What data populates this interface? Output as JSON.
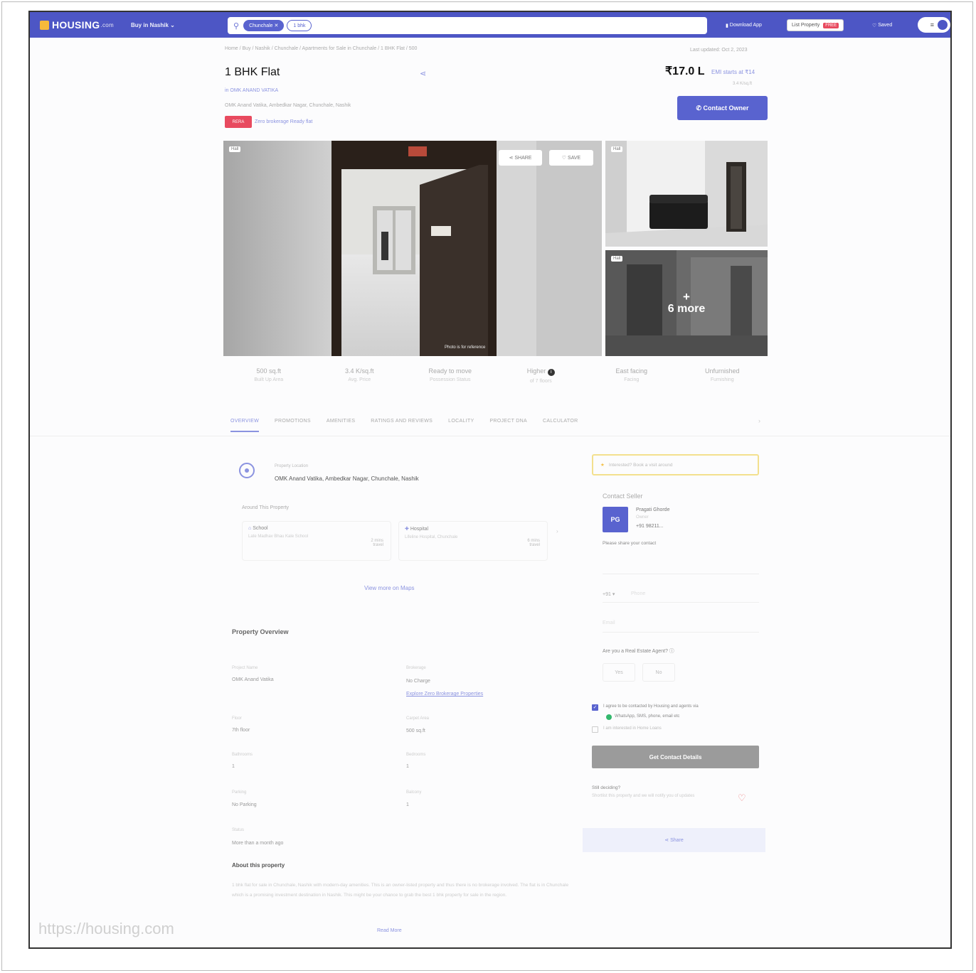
{
  "navbar": {
    "logo": "HOUSING",
    "logo_suffix": ".com",
    "city": "Buy in Nashik",
    "search": {
      "chips": [
        "Chunchale",
        "1 bhk"
      ]
    },
    "download_app": "Download App",
    "list_property": "List Property",
    "list_property_badge": "FREE",
    "saved": "Saved"
  },
  "listing": {
    "breadcrumb": "Home / Buy / Nashik / Chunchale / Apartments for Sale in Chunchale / 1 BHK Flat / 500",
    "last_updated": "Last updated: Oct 2, 2023",
    "title": "1 BHK Flat",
    "price": "₹17.0 L",
    "emi": "EMI starts at ₹14",
    "price_per_sqft": "3.4 K/sq.ft",
    "project": "in OMK ANAND VATIKA",
    "address": "OMK Anand Vatika, Ambedkar Nagar, Chunchale, Nashik",
    "badge": "RERA",
    "zero_brokerage": "Zero brokerage Ready flat",
    "contact_button": "Contact Owner"
  },
  "gallery": {
    "tag_main": "Hall",
    "tag_2": "Hall",
    "tag_3": "Hall",
    "share_label": "SHARE",
    "save_label": "SAVE",
    "watermark": "Photo is for reference",
    "more_plus": "+",
    "more_label": "6 more"
  },
  "stats": [
    {
      "value": "500 sq.ft",
      "label": "Built Up Area"
    },
    {
      "value": "3.4 K/sq.ft",
      "label": "Avg. Price"
    },
    {
      "value": "Ready to move",
      "label": "Possession Status"
    },
    {
      "value": "Higher",
      "label": "of 7 floors"
    },
    {
      "value": "East facing",
      "label": "Facing"
    },
    {
      "value": "Unfurnished",
      "label": "Furnishing"
    }
  ],
  "tabs": [
    "OVERVIEW",
    "PROMOTIONS",
    "AMENITIES",
    "RATINGS AND REVIEWS",
    "LOCALITY",
    "PROJECT DNA",
    "CALCULATOR"
  ],
  "location": {
    "label": "Property Location",
    "value": "OMK Anand Vatika, Ambedkar Nagar, Chunchale, Nashik",
    "around_title": "Around This Property",
    "cards": [
      {
        "type": "School",
        "name": "Late Madhav Bhau Kale School",
        "distance": "2 mins",
        "unit": "travel"
      },
      {
        "type": "Hospital",
        "name": "Lifeline Hospital, Chunchale",
        "distance": "6 mins",
        "unit": "travel"
      }
    ],
    "view_maps": "View more on Maps"
  },
  "overview": {
    "title": "Property Overview",
    "project_name_label": "Project Name",
    "project_name": "OMK Anand Vatika",
    "brokerage_label": "Brokerage",
    "brokerage": "No Charge",
    "brokerage_link": "Explore Zero Brokerage Properties",
    "floor_label": "Floor",
    "floor": "7th floor",
    "carpet_label": "Carpet Area",
    "carpet": "500 sq.ft",
    "bathrooms_label": "Bathrooms",
    "bathrooms": "1",
    "bedrooms_label": "Bedrooms",
    "bedrooms": "1",
    "parking_label": "Parking",
    "parking": "No Parking",
    "balcony_label": "Balcony",
    "balcony": "1",
    "status_label": "Status",
    "status": "More than a month ago",
    "about_title": "About this property",
    "about_text": "1 bhk flat for sale in Chunchale, Nashik with modern-day amenities. This is an owner-listed property and thus there is no brokerage involved. The flat is in Chunchale which is a promising investment destination in Nashik. This might be your chance to grab the best 1 bhk property for sale in the region.",
    "read_more": "Read More"
  },
  "sidebar": {
    "alert": "Interested? Book a visit around",
    "contact_seller": "Contact Seller",
    "agent_initials": "PG",
    "agent_name": "Pragati Ghorde",
    "agent_role": "Owner",
    "agent_phone": "+91 98211...",
    "share_contact": "Please share your contact",
    "country_code": "+91",
    "phone_placeholder": "Phone",
    "email_placeholder": "Email",
    "agent_question": "Are you a Real Estate Agent?",
    "yes": "Yes",
    "no": "No",
    "consent": "I agree to be contacted by Housing and agents via",
    "consent2": "WhatsApp, SMS, phone, email etc",
    "home_loan": "I am interested in Home Loans",
    "get_details": "Get Contact Details",
    "still_deciding": "Still deciding?",
    "still_text": "Shortlist this property and we will notify you of updates",
    "share_btn": "Share"
  },
  "watermark_url": "https://housing.com",
  "colors": {
    "brand": "#4d56c5",
    "accent": "#5963cf",
    "rera": "#e84a5f"
  }
}
